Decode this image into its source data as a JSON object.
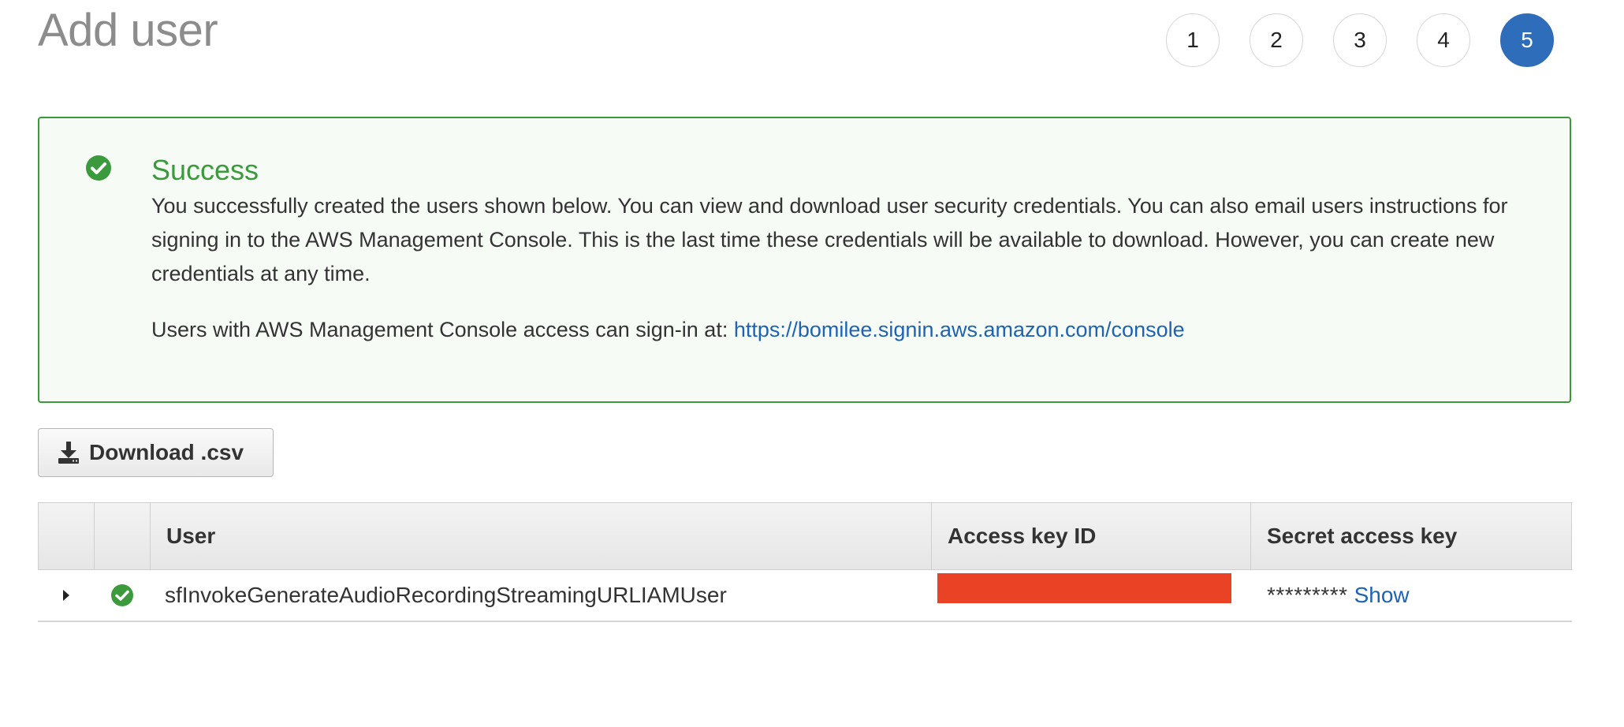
{
  "page": {
    "title": "Add user"
  },
  "steps": [
    {
      "label": "1",
      "active": false
    },
    {
      "label": "2",
      "active": false
    },
    {
      "label": "3",
      "active": false
    },
    {
      "label": "4",
      "active": false
    },
    {
      "label": "5",
      "active": true
    }
  ],
  "alert": {
    "icon": "check-circle-icon",
    "title": "Success",
    "body": "You successfully created the users shown below. You can view and download user security credentials. You can also email users instructions for signing in to the AWS Management Console. This is the last time these credentials will be available to download. However, you can create new credentials at any time.",
    "signin_text": "Users with AWS Management Console access can sign-in at: ",
    "signin_url": "https://bomilee.signin.aws.amazon.com/console",
    "color": "#3b9a3b"
  },
  "download": {
    "icon": "download-icon",
    "label": "Download .csv"
  },
  "table": {
    "columns": [
      "",
      "",
      "User",
      "Access key ID",
      "Secret access key"
    ],
    "rows": [
      {
        "expand_icon": "caret-right-icon",
        "status_icon": "check-circle-icon",
        "user": "sfInvokeGenerateAudioRecordingStreamingURLIAMUser",
        "access_key_id_redacted": true,
        "secret_mask": "*********",
        "secret_action": "Show"
      }
    ]
  },
  "colors": {
    "accent": "#2e6db9",
    "link": "#1d62b5",
    "success": "#3b9a3b",
    "redaction": "#ea4224"
  }
}
